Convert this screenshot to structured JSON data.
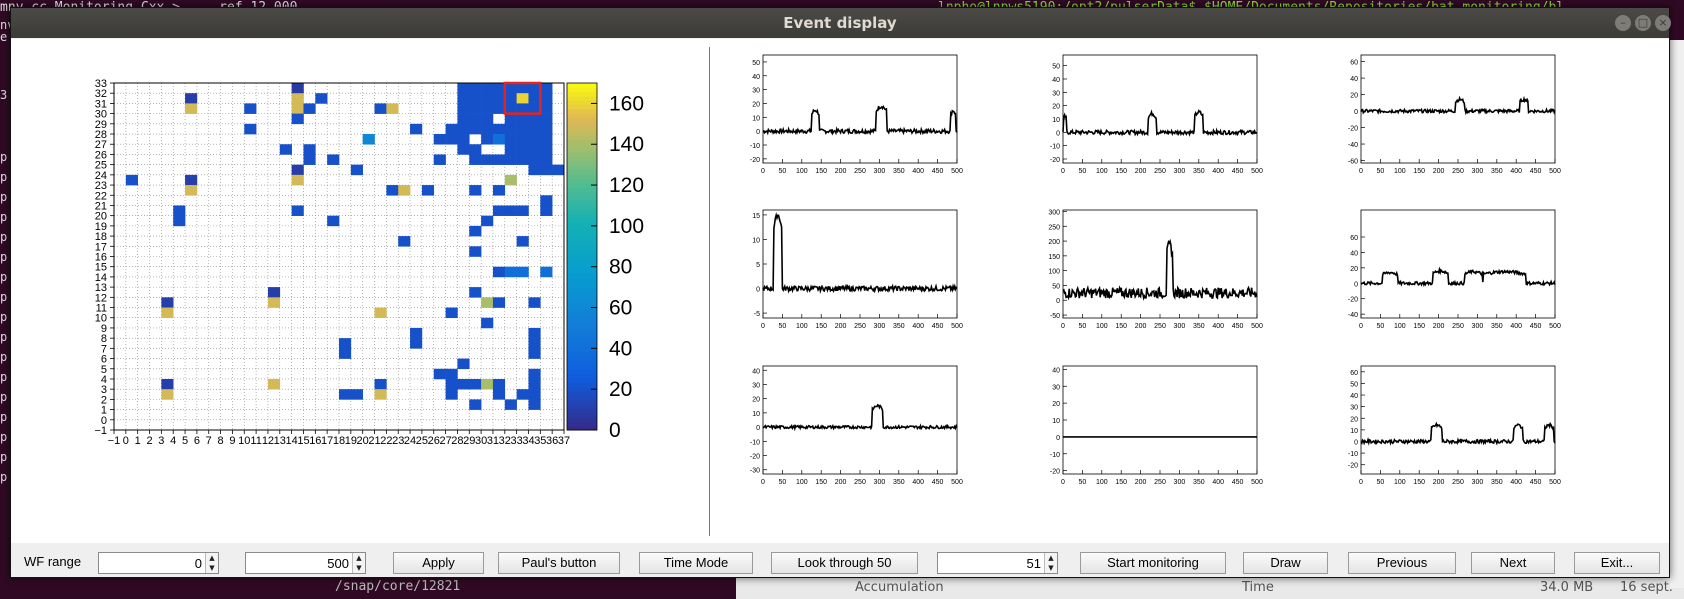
{
  "background": {
    "terminal_top_left": "mny.cc Monitoring.Cxx > ... ref 12.000",
    "terminal_top_right": "lnpho@lnpws5190:/opt2/pulserData$ $HOME/Documents/Repositories/bat_monitoring/bl",
    "terminal_bottom": "/snap/core/12821",
    "left_letters": [
      "nv",
      "e",
      "3",
      "p",
      "p",
      "p",
      "p",
      "p",
      "p",
      "p",
      "p",
      "p",
      "p",
      "p",
      "p",
      "p",
      "p",
      "p",
      "p",
      "p"
    ],
    "bottom_right": {
      "accumulation": "Accumulation",
      "time": "Time",
      "size": "34.0 MB",
      "date": "16 sept."
    }
  },
  "window": {
    "title": "Event display",
    "controls": {
      "minimize": "–",
      "maximize": "□",
      "close": "×"
    }
  },
  "heatmap": {
    "x_ticks": [
      "−1",
      "0",
      "1",
      "2",
      "3",
      "4",
      "5",
      "6",
      "7",
      "8",
      "9",
      "10",
      "11",
      "12",
      "13",
      "14",
      "15",
      "16",
      "17",
      "18",
      "19",
      "20",
      "21",
      "22",
      "23",
      "24",
      "25",
      "26",
      "27",
      "28",
      "29",
      "30",
      "31",
      "32",
      "33",
      "34",
      "35",
      "36",
      "37"
    ],
    "y_ticks": [
      "−1",
      "0",
      "1",
      "2",
      "3",
      "4",
      "5",
      "6",
      "7",
      "8",
      "9",
      "10",
      "11",
      "12",
      "13",
      "14",
      "15",
      "16",
      "17",
      "18",
      "19",
      "20",
      "21",
      "22",
      "23",
      "24",
      "25",
      "26",
      "27",
      "28",
      "29",
      "30",
      "31",
      "32",
      "33"
    ],
    "colorbar_ticks": [
      "0",
      "20",
      "40",
      "60",
      "80",
      "100",
      "120",
      "140",
      "160"
    ]
  },
  "waveforms": [
    {
      "y_ticks": [
        "50",
        "40",
        "30",
        "20",
        "10",
        "0",
        "-10",
        "-20"
      ],
      "x_ticks": [
        "0",
        "50",
        "100",
        "150",
        "200",
        "250",
        "300",
        "350",
        "400",
        "450",
        "500"
      ]
    },
    {
      "y_ticks": [
        "50",
        "40",
        "30",
        "20",
        "10",
        "0",
        "-10",
        "-20"
      ],
      "x_ticks": [
        "0",
        "50",
        "100",
        "150",
        "200",
        "250",
        "300",
        "350",
        "400",
        "450",
        "500"
      ]
    },
    {
      "y_ticks": [
        "60",
        "40",
        "20",
        "0",
        "-20",
        "-40",
        "-60"
      ],
      "x_ticks": [
        "0",
        "50",
        "100",
        "150",
        "200",
        "250",
        "300",
        "350",
        "400",
        "450",
        "500"
      ]
    },
    {
      "y_ticks": [
        "15",
        "10",
        "5",
        "0",
        "-5"
      ],
      "x_ticks": [
        "0",
        "50",
        "100",
        "150",
        "200",
        "250",
        "300",
        "350",
        "400",
        "450",
        "500"
      ]
    },
    {
      "y_ticks": [
        "300",
        "250",
        "200",
        "150",
        "100",
        "50",
        "0",
        "-50"
      ],
      "x_ticks": [
        "0",
        "50",
        "100",
        "150",
        "200",
        "250",
        "300",
        "350",
        "400",
        "450",
        "500"
      ]
    },
    {
      "y_ticks": [
        "60",
        "40",
        "20",
        "0",
        "-20",
        "-40"
      ],
      "x_ticks": [
        "0",
        "50",
        "100",
        "150",
        "200",
        "250",
        "300",
        "350",
        "400",
        "450",
        "500"
      ]
    },
    {
      "y_ticks": [
        "40",
        "30",
        "20",
        "10",
        "0",
        "-10",
        "-20",
        "-30"
      ],
      "x_ticks": [
        "0",
        "50",
        "100",
        "150",
        "200",
        "250",
        "300",
        "350",
        "400",
        "450",
        "500"
      ]
    },
    {
      "y_ticks": [
        "40",
        "30",
        "20",
        "10",
        "0",
        "-10",
        "-20"
      ],
      "x_ticks": [
        "0",
        "50",
        "100",
        "150",
        "200",
        "250",
        "300",
        "350",
        "400",
        "450",
        "500"
      ]
    },
    {
      "y_ticks": [
        "60",
        "50",
        "40",
        "30",
        "20",
        "10",
        "0",
        "-10",
        "-20"
      ],
      "x_ticks": [
        "0",
        "50",
        "100",
        "150",
        "200",
        "250",
        "300",
        "350",
        "400",
        "450",
        "500"
      ]
    }
  ],
  "toolbar": {
    "wf_range_label": "WF range",
    "wf_min": "0",
    "wf_max": "500",
    "apply": "Apply",
    "pauls_button": "Paul's button",
    "time_mode": "Time Mode",
    "look_through": "Look through 50",
    "event_number": "51",
    "start_monitoring": "Start monitoring",
    "draw": "Draw",
    "previous": "Previous",
    "next": "Next",
    "exit": "Exit..."
  },
  "colors": {
    "window_bg": "#f2f1f0",
    "titlebar": "#3c3b37",
    "highlight_box": "#e8221c"
  },
  "chart_data": [
    {
      "type": "heatmap",
      "xlim": [
        -1,
        37
      ],
      "ylim": [
        -1,
        33
      ],
      "zlim": [
        0,
        170
      ],
      "colormap": "parula",
      "grid": true,
      "highlight_cell": {
        "x": 33,
        "y": 31
      },
      "cells": [
        [
          5,
          31,
          10
        ],
        [
          14,
          32,
          8
        ],
        [
          14,
          31,
          150
        ],
        [
          16,
          31,
          20
        ],
        [
          5,
          30,
          150
        ],
        [
          10,
          30,
          20
        ],
        [
          14,
          30,
          150
        ],
        [
          15,
          30,
          20
        ],
        [
          21,
          30,
          20
        ],
        [
          22,
          30,
          150
        ],
        [
          10,
          28,
          20
        ],
        [
          24,
          28,
          20
        ],
        [
          14,
          29,
          20
        ],
        [
          20,
          27,
          60
        ],
        [
          13,
          26,
          20
        ],
        [
          15,
          25,
          20
        ],
        [
          15,
          26,
          20
        ],
        [
          17,
          25,
          20
        ],
        [
          19,
          24,
          20
        ],
        [
          14,
          24,
          10
        ],
        [
          5,
          23,
          10
        ],
        [
          14,
          23,
          150
        ],
        [
          0,
          23,
          20
        ],
        [
          5,
          22,
          150
        ],
        [
          22,
          22,
          20
        ],
        [
          23,
          22,
          150
        ],
        [
          25,
          22,
          20
        ],
        [
          29,
          22,
          20
        ],
        [
          31,
          22,
          20
        ],
        [
          32,
          23,
          140
        ],
        [
          35,
          21,
          20
        ],
        [
          4,
          19,
          20
        ],
        [
          4,
          20,
          20
        ],
        [
          14,
          20,
          20
        ],
        [
          17,
          19,
          20
        ],
        [
          30,
          19,
          20
        ],
        [
          31,
          20,
          20
        ],
        [
          32,
          20,
          20
        ],
        [
          33,
          20,
          20
        ],
        [
          35,
          20,
          20
        ],
        [
          23,
          17,
          20
        ],
        [
          29,
          18,
          20
        ],
        [
          29,
          16,
          20
        ],
        [
          33,
          17,
          20
        ],
        [
          31,
          14,
          20
        ],
        [
          33,
          14,
          40
        ],
        [
          32,
          14,
          40
        ],
        [
          35,
          14,
          40
        ],
        [
          29,
          12,
          20
        ],
        [
          12,
          12,
          10
        ],
        [
          3,
          11,
          10
        ],
        [
          12,
          11,
          150
        ],
        [
          3,
          10,
          150
        ],
        [
          21,
          10,
          150
        ],
        [
          27,
          10,
          20
        ],
        [
          30,
          11,
          140
        ],
        [
          31,
          11,
          20
        ],
        [
          34,
          11,
          20
        ],
        [
          30,
          9,
          20
        ],
        [
          34,
          8,
          20
        ],
        [
          24,
          8,
          20
        ],
        [
          18,
          7,
          20
        ],
        [
          24,
          7,
          20
        ],
        [
          34,
          7,
          20
        ],
        [
          18,
          6,
          20
        ],
        [
          34,
          6,
          20
        ],
        [
          28,
          5,
          20
        ],
        [
          26,
          4,
          20
        ],
        [
          27,
          4,
          20
        ],
        [
          34,
          4,
          20
        ],
        [
          3,
          3,
          10
        ],
        [
          12,
          3,
          150
        ],
        [
          21,
          3,
          20
        ],
        [
          27,
          3,
          20
        ],
        [
          28,
          3,
          20
        ],
        [
          29,
          3,
          20
        ],
        [
          30,
          3,
          140
        ],
        [
          31,
          3,
          20
        ],
        [
          34,
          3,
          20
        ],
        [
          3,
          2,
          150
        ],
        [
          18,
          2,
          20
        ],
        [
          19,
          2,
          20
        ],
        [
          21,
          2,
          150
        ],
        [
          27,
          2,
          20
        ],
        [
          31,
          2,
          20
        ],
        [
          33,
          2,
          20
        ],
        [
          34,
          2,
          20
        ],
        [
          29,
          1,
          20
        ],
        [
          32,
          1,
          20
        ],
        [
          34,
          1,
          20
        ],
        [
          28,
          32,
          20
        ],
        [
          29,
          32,
          20
        ],
        [
          30,
          32,
          20
        ],
        [
          31,
          32,
          20
        ],
        [
          32,
          32,
          20
        ],
        [
          33,
          32,
          20
        ],
        [
          34,
          32,
          20
        ],
        [
          35,
          32,
          20
        ],
        [
          28,
          31,
          20
        ],
        [
          29,
          31,
          20
        ],
        [
          30,
          31,
          20
        ],
        [
          31,
          31,
          20
        ],
        [
          32,
          31,
          20
        ],
        [
          33,
          31,
          160
        ],
        [
          34,
          31,
          20
        ],
        [
          35,
          31,
          20
        ],
        [
          28,
          30,
          20
        ],
        [
          29,
          30,
          20
        ],
        [
          30,
          30,
          20
        ],
        [
          31,
          30,
          20
        ],
        [
          32,
          30,
          20
        ],
        [
          33,
          30,
          20
        ],
        [
          34,
          30,
          20
        ],
        [
          35,
          30,
          20
        ],
        [
          28,
          29,
          20
        ],
        [
          29,
          29,
          20
        ],
        [
          30,
          29,
          20
        ],
        [
          32,
          29,
          20
        ],
        [
          33,
          29,
          20
        ],
        [
          34,
          29,
          20
        ],
        [
          35,
          29,
          20
        ],
        [
          27,
          28,
          20
        ],
        [
          28,
          28,
          20
        ],
        [
          29,
          28,
          20
        ],
        [
          30,
          28,
          20
        ],
        [
          31,
          28,
          20
        ],
        [
          32,
          28,
          20
        ],
        [
          33,
          28,
          20
        ],
        [
          34,
          28,
          20
        ],
        [
          35,
          28,
          20
        ],
        [
          26,
          27,
          20
        ],
        [
          27,
          27,
          20
        ],
        [
          28,
          27,
          20
        ],
        [
          30,
          27,
          20
        ],
        [
          31,
          27,
          40
        ],
        [
          32,
          27,
          20
        ],
        [
          33,
          27,
          20
        ],
        [
          34,
          27,
          20
        ],
        [
          35,
          27,
          20
        ],
        [
          28,
          26,
          20
        ],
        [
          29,
          26,
          20
        ],
        [
          32,
          26,
          20
        ],
        [
          33,
          26,
          20
        ],
        [
          34,
          26,
          20
        ],
        [
          35,
          26,
          20
        ],
        [
          26,
          25,
          20
        ],
        [
          29,
          25,
          20
        ],
        [
          30,
          25,
          20
        ],
        [
          31,
          25,
          20
        ],
        [
          32,
          25,
          20
        ],
        [
          33,
          25,
          20
        ],
        [
          34,
          25,
          20
        ],
        [
          35,
          25,
          20
        ],
        [
          34,
          24,
          20
        ],
        [
          35,
          24,
          20
        ],
        [
          36,
          24,
          20
        ]
      ]
    },
    {
      "type": "line",
      "xlim": [
        0,
        500
      ],
      "ylim": [
        -23,
        55
      ],
      "baseline": 0,
      "noise": 1.5,
      "pulses": [
        [
          135,
          15,
          20
        ],
        [
          305,
          18,
          28
        ],
        [
          490,
          15,
          12
        ]
      ]
    },
    {
      "type": "line",
      "xlim": [
        0,
        500
      ],
      "ylim": [
        -23,
        58
      ],
      "baseline": 0,
      "noise": 1.5,
      "pulses": [
        [
          5,
          12,
          8
        ],
        [
          230,
          14,
          20
        ],
        [
          350,
          15,
          22
        ]
      ]
    },
    {
      "type": "line",
      "xlim": [
        0,
        500
      ],
      "ylim": [
        -63,
        68
      ],
      "baseline": 0,
      "noise": 2,
      "pulses": [
        [
          255,
          14,
          22
        ],
        [
          420,
          14,
          22
        ]
      ]
    },
    {
      "type": "line",
      "xlim": [
        0,
        500
      ],
      "ylim": [
        -6,
        16
      ],
      "baseline": 0,
      "noise": 0.5,
      "pulses": [
        [
          38,
          15,
          22
        ]
      ]
    },
    {
      "type": "line",
      "xlim": [
        0,
        500
      ],
      "ylim": [
        -60,
        305
      ],
      "baseline": 25,
      "noise": 18,
      "pulses": [
        [
          275,
          160,
          16
        ]
      ]
    },
    {
      "type": "line",
      "xlim": [
        0,
        500
      ],
      "ylim": [
        -45,
        95
      ],
      "baseline": 0,
      "noise": 2,
      "pulses": [
        [
          75,
          14,
          40
        ],
        [
          205,
          16,
          40
        ],
        [
          290,
          15,
          45
        ],
        [
          370,
          15,
          110
        ]
      ]
    },
    {
      "type": "line",
      "xlim": [
        0,
        500
      ],
      "ylim": [
        -33,
        43
      ],
      "baseline": 0,
      "noise": 1,
      "pulses": [
        [
          295,
          15,
          28
        ]
      ]
    },
    {
      "type": "line",
      "xlim": [
        0,
        500
      ],
      "ylim": [
        -22,
        42
      ],
      "baseline": 0,
      "noise": 0,
      "pulses": []
    },
    {
      "type": "line",
      "xlim": [
        0,
        500
      ],
      "ylim": [
        -28,
        65
      ],
      "baseline": 0,
      "noise": 1.5,
      "pulses": [
        [
          195,
          14,
          28
        ],
        [
          405,
          14,
          25
        ],
        [
          485,
          14,
          25
        ]
      ]
    }
  ]
}
